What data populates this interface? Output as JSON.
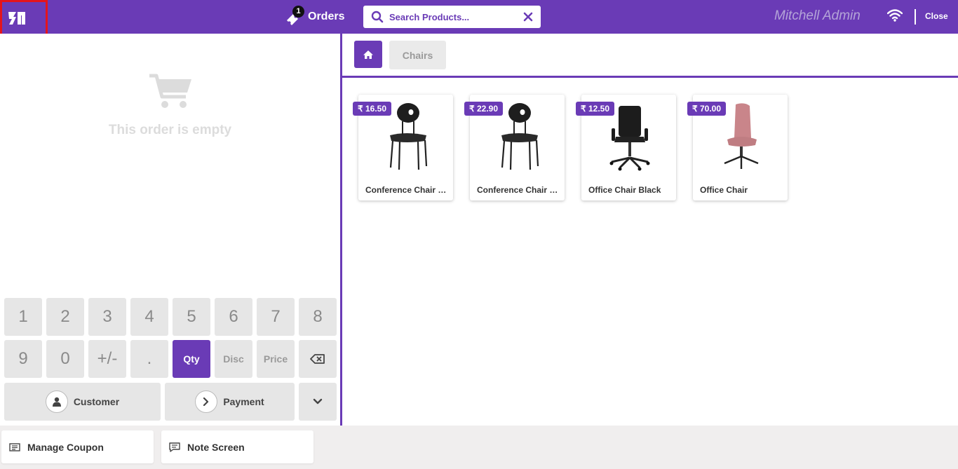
{
  "header": {
    "logo_icon": "odoo-pos-logo-icon",
    "orders_label": "Orders",
    "orders_count": "1",
    "search_placeholder": "Search Products...",
    "cashier_name": "Mitchell Admin",
    "close_label": "Close",
    "accent_color": "#6a3bb6"
  },
  "order": {
    "empty_text": "This order is empty",
    "empty_icon": "shopping-cart-icon"
  },
  "numpad": {
    "row1": [
      "1",
      "2",
      "3",
      "4",
      "5",
      "6",
      "7",
      "8"
    ],
    "row2": [
      "9",
      "0",
      "+/-",
      "."
    ],
    "modes": {
      "qty": "Qty",
      "disc": "Disc",
      "price": "Price"
    },
    "active_mode": "Qty",
    "backspace_icon": "backspace-icon",
    "customer_label": "Customer",
    "payment_label": "Payment",
    "more_icon": "chevron-down-icon"
  },
  "breadcrumb": {
    "home_icon": "home-icon",
    "category": "Chairs"
  },
  "products": [
    {
      "name": "Conference Chair (Steel)",
      "price": "₹ 16.50"
    },
    {
      "name": "Conference Chair (Aluminium)",
      "price": "₹ 22.90"
    },
    {
      "name": "Office Chair Black",
      "price": "₹ 12.50"
    },
    {
      "name": "Office Chair",
      "price": "₹ 70.00"
    }
  ],
  "footer": {
    "coupon_label": "Manage Coupon",
    "note_label": "Note Screen"
  }
}
